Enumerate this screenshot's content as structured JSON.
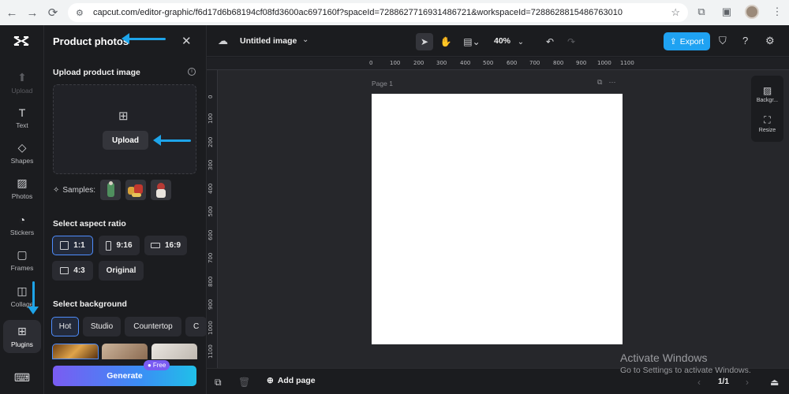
{
  "browser": {
    "url": "capcut.com/editor-graphic/f6d17d6b68194cf08fd3600ac697160f?spaceId=7288627716931486721&workspaceId=7288628815486763010"
  },
  "rail": {
    "items": [
      {
        "label": "Upload"
      },
      {
        "label": "Text"
      },
      {
        "label": "Shapes"
      },
      {
        "label": "Photos"
      },
      {
        "label": "Stickers"
      },
      {
        "label": "Frames"
      },
      {
        "label": "Collage"
      },
      {
        "label": "Plugins"
      }
    ]
  },
  "panel": {
    "title": "Product photos",
    "upload_section": "Upload product image",
    "upload_button": "Upload",
    "samples_label": "Samples:",
    "aspect_section": "Select aspect ratio",
    "ratios": [
      "1:1",
      "9:16",
      "16:9",
      "4:3",
      "Original"
    ],
    "background_section": "Select background",
    "backgrounds": [
      "Hot",
      "Studio",
      "Countertop",
      "C"
    ],
    "generate_button": "Generate",
    "free_badge": "Free"
  },
  "topbar": {
    "doc_title": "Untitled image",
    "zoom": "40%",
    "export_button": "Export"
  },
  "canvas": {
    "page_label": "Page 1",
    "ruler_top": [
      "0",
      "100",
      "200",
      "300",
      "400",
      "500",
      "600",
      "700",
      "800",
      "900",
      "1000",
      "1100"
    ],
    "ruler_left": [
      "0",
      "100",
      "200",
      "300",
      "400",
      "500",
      "600",
      "700",
      "800",
      "900",
      "1000",
      "1100"
    ],
    "side": {
      "background": "Backgr...",
      "resize": "Resize"
    }
  },
  "bottombar": {
    "add_page": "Add page",
    "page_count": "1/1"
  },
  "watermark": {
    "line1": "Activate Windows",
    "line2": "Go to Settings to activate Windows."
  },
  "colors": {
    "accent": "#1fa2f2",
    "annotation_arrow": "#1ea4e9",
    "selected_border": "#4e8dfd"
  }
}
